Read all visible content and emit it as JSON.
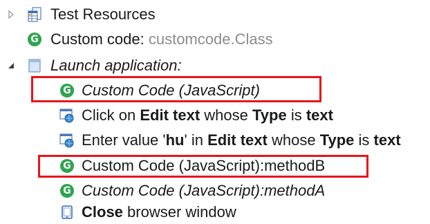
{
  "tree": {
    "test_resources": {
      "label": "Test Resources",
      "icon": "table-icon"
    },
    "custom_code_class": {
      "prefix": "Custom code: ",
      "class_name": "customcode.Class",
      "icon": "custom-code-icon"
    },
    "launch_application": {
      "label": "Launch application:",
      "icon": "test-step-icon"
    },
    "step_custom_code_js": {
      "label": "Custom Code (JavaScript)",
      "icon": "custom-code-icon"
    },
    "step_click": {
      "p1": "Click on ",
      "b1": "Edit text",
      "p2": " whose ",
      "b2": "Type",
      "p3": " is ",
      "b3": "text",
      "icon": "web-action-icon"
    },
    "step_enter": {
      "p1": "Enter value '",
      "b1": "hu",
      "p2": "' in ",
      "b2": "Edit text",
      "p3": " whose ",
      "b3": "Type",
      "p4": " is ",
      "b4": "text",
      "icon": "web-action-icon"
    },
    "step_method_b": {
      "label": "Custom Code (JavaScript):methodB",
      "icon": "custom-code-icon"
    },
    "step_method_a": {
      "label": "Custom Code (JavaScript):methodA",
      "icon": "custom-code-icon"
    },
    "step_close": {
      "b1": "Close",
      "p1": " browser window",
      "icon": "device-icon"
    }
  },
  "colors": {
    "highlight_border": "#e8141a",
    "custom_code_green": "#2ea44f",
    "dim_text": "#8c8c8c"
  }
}
